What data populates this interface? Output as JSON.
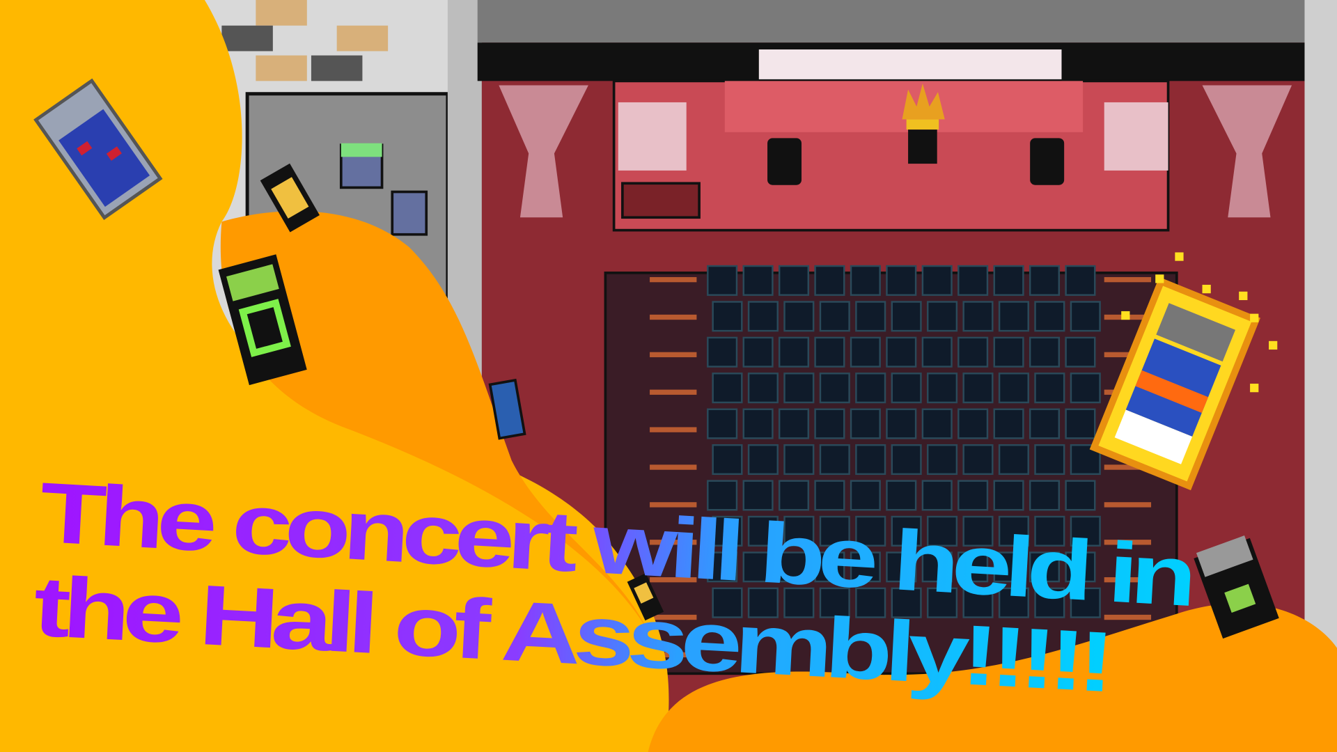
{
  "headline": {
    "line1": "The concert will be held in",
    "line2": "the Hall of Assembly!!!!!"
  },
  "colors": {
    "background_yellow": "#ffb800",
    "blob_orange": "#ff9a00",
    "stage_red": "#c94a55",
    "floor_red": "#8e2a33",
    "seat_navy": "#0f1b2a",
    "text_gradient_start": "#a014ff",
    "text_gradient_end": "#00c8ff"
  },
  "scene": {
    "seat_rows": 10,
    "seat_columns": 11
  }
}
